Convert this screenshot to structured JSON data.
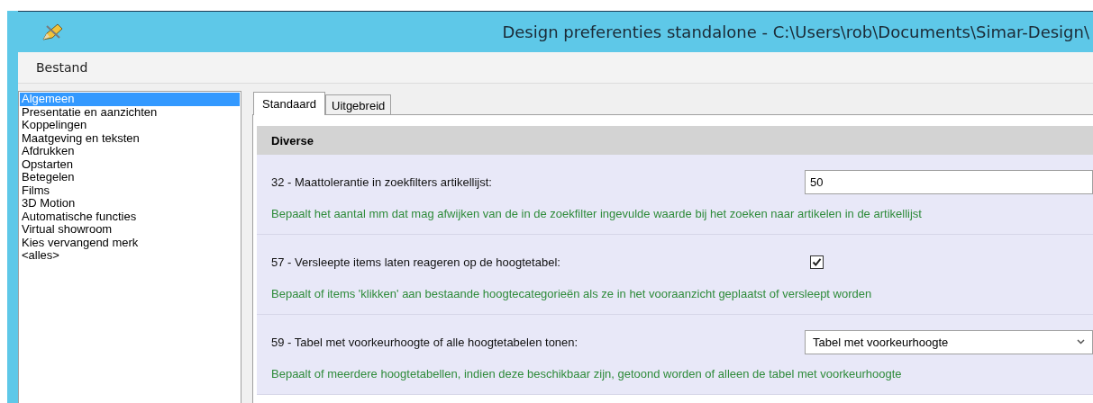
{
  "window": {
    "title": "Design preferenties standalone - C:\\Users\\rob\\Documents\\Simar-Design\\"
  },
  "menu": [
    "Bestand"
  ],
  "sidebar": {
    "items": [
      {
        "label": "Algemeen",
        "selected": true
      },
      {
        "label": "Presentatie en aanzichten",
        "selected": false
      },
      {
        "label": "Koppelingen",
        "selected": false
      },
      {
        "label": "Maatgeving en teksten",
        "selected": false
      },
      {
        "label": "Afdrukken",
        "selected": false
      },
      {
        "label": "Opstarten",
        "selected": false
      },
      {
        "label": "Betegelen",
        "selected": false
      },
      {
        "label": "Films",
        "selected": false
      },
      {
        "label": "3D Motion",
        "selected": false
      },
      {
        "label": "Automatische functies",
        "selected": false
      },
      {
        "label": "Virtual showroom",
        "selected": false
      },
      {
        "label": "Kies vervangend merk",
        "selected": false
      },
      {
        "label": "<alles>",
        "selected": false
      }
    ]
  },
  "tabs": [
    {
      "label": "Standaard",
      "selected": true
    },
    {
      "label": "Uitgebreid",
      "selected": false
    }
  ],
  "section": {
    "title": "Diverse"
  },
  "settings": [
    {
      "kind": "text",
      "label": "32 - Maattolerantie in zoekfilters artikellijst:",
      "value": "50",
      "description": "Bepaalt het aantal mm dat mag afwijken van de in de zoekfilter ingevulde waarde bij het zoeken naar artikelen in de artikellijst"
    },
    {
      "kind": "checkbox",
      "label": "57 - Versleepte items laten reageren op de hoogtetabel:",
      "checked": true,
      "description": "Bepaalt of items 'klikken' aan bestaande hoogtecategorieën als ze in het vooraanzicht geplaatst of versleept worden"
    },
    {
      "kind": "select",
      "label": "59 - Tabel met voorkeurhoogte of alle hoogtetabelen tonen:",
      "value": "Tabel met voorkeurhoogte",
      "description": "Bepaalt of meerdere hoogtetabellen, indien deze beschikbaar zijn, getoond worden of alleen de tabel met voorkeurhoogte"
    }
  ]
}
